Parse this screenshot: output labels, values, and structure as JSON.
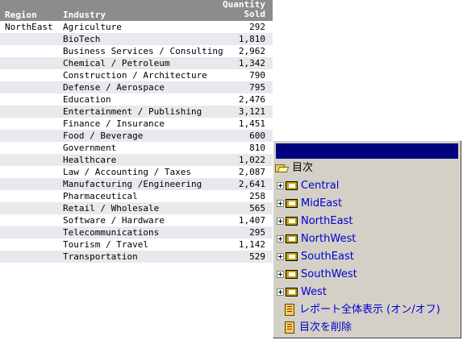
{
  "report": {
    "headers": {
      "region": "Region",
      "industry": "Industry",
      "qty_line1": "Quantity",
      "qty_line2": "Sold"
    },
    "rows": [
      {
        "region": "NorthEast",
        "industry": "Agriculture",
        "qty": "292"
      },
      {
        "region": "",
        "industry": "BioTech",
        "qty": "1,810"
      },
      {
        "region": "",
        "industry": "Business Services / Consulting",
        "qty": "2,962"
      },
      {
        "region": "",
        "industry": "Chemical / Petroleum",
        "qty": "1,342"
      },
      {
        "region": "",
        "industry": "Construction / Architecture",
        "qty": "790"
      },
      {
        "region": "",
        "industry": "Defense / Aerospace",
        "qty": "795"
      },
      {
        "region": "",
        "industry": "Education",
        "qty": "2,476"
      },
      {
        "region": "",
        "industry": "Entertainment / Publishing",
        "qty": "3,121"
      },
      {
        "region": "",
        "industry": "Finance / Insurance",
        "qty": "1,451"
      },
      {
        "region": "",
        "industry": "Food / Beverage",
        "qty": "600"
      },
      {
        "region": "",
        "industry": "Government",
        "qty": "810"
      },
      {
        "region": "",
        "industry": "Healthcare",
        "qty": "1,022"
      },
      {
        "region": "",
        "industry": "Law / Accounting / Taxes",
        "qty": "2,087"
      },
      {
        "region": "",
        "industry": "Manufacturing /Engineering",
        "qty": "2,641"
      },
      {
        "region": "",
        "industry": "Pharmaceutical",
        "qty": "258"
      },
      {
        "region": "",
        "industry": "Retail / Wholesale",
        "qty": "565"
      },
      {
        "region": "",
        "industry": "Software / Hardware",
        "qty": "1,407"
      },
      {
        "region": "",
        "industry": "Telecommunications",
        "qty": "295"
      },
      {
        "region": "",
        "industry": "Tourism / Travel",
        "qty": "1,142"
      },
      {
        "region": "",
        "industry": "Transportation",
        "qty": "529"
      }
    ]
  },
  "toc": {
    "title": "",
    "root": {
      "label": "目次",
      "icon": "open-folder-icon"
    },
    "regions": [
      {
        "label": "Central"
      },
      {
        "label": "MidEast"
      },
      {
        "label": "NorthEast"
      },
      {
        "label": "NorthWest"
      },
      {
        "label": "SouthEast"
      },
      {
        "label": "SouthWest"
      },
      {
        "label": "West"
      }
    ],
    "commands": [
      {
        "label": "レポート全体表示 (オン/オフ)",
        "icon": "report-page-icon"
      },
      {
        "label": "目次を削除",
        "icon": "report-page-icon"
      }
    ]
  },
  "colors": {
    "header_bg": "#8c8c8c",
    "row_alt_bg": "#e8e8ee",
    "toc_bg": "#d4d0c8",
    "toc_titlebar": "#000080",
    "link": "#0000cc"
  }
}
